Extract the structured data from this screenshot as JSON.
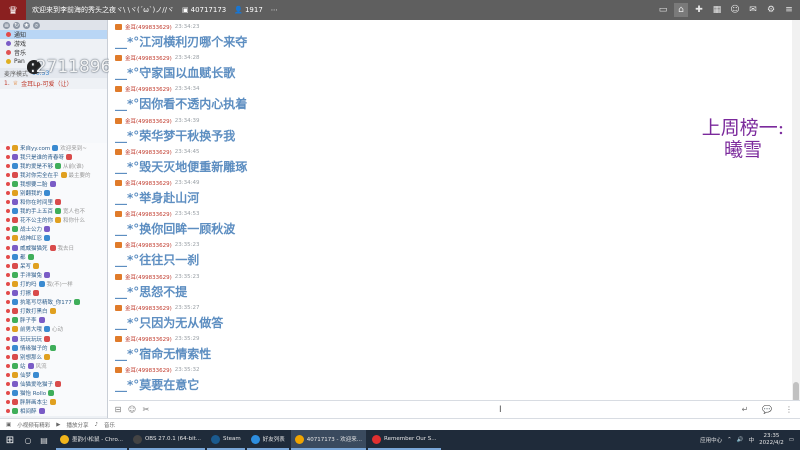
{
  "topbar": {
    "logo": "♛",
    "room_title": "欢迎来到李前海的秀头之夜ヾ\\ \\ヾ(´ω`)ノ//ヾ",
    "room_id": "40717173",
    "viewer_count": "1917",
    "icons": [
      "monitor-icon",
      "home-icon",
      "gamepad-icon",
      "gift-icon",
      "user-icon",
      "mail-icon",
      "settings-icon",
      "menu-icon"
    ]
  },
  "left": {
    "channels": [
      {
        "label": "通知",
        "color": "#e24a4a",
        "selected": true
      },
      {
        "label": "游戏",
        "color": "#7a5cc6",
        "selected": false
      },
      {
        "label": "音乐",
        "color": "#e05353",
        "selected": false
      },
      {
        "label": "Pan",
        "color": "#e0b020",
        "selected": false
      }
    ],
    "mode_label": "麦序模式",
    "mode_time": "00:53",
    "pinned_index": "1.",
    "pinned_text": "金耳Lp-可爱（让）",
    "watermark": ":27118960",
    "users": [
      {
        "name": "来自yy.com",
        "msg": "欢迎来到~"
      },
      {
        "name": "我只是谁的青春呀",
        "msg": ""
      },
      {
        "name": "我的爱是不够",
        "msg": "从前(谁)"
      },
      {
        "name": "我对你完全在乎",
        "msg": "最主要的"
      },
      {
        "name": "我想要二胎",
        "msg": ""
      },
      {
        "name": "别翻我的",
        "msg": ""
      },
      {
        "name": "和你在时间里",
        "msg": ""
      },
      {
        "name": "我的手上五百",
        "msg": "宽人也不"
      },
      {
        "name": "花不公主的你",
        "msg": "和你什么"
      },
      {
        "name": "战士公力",
        "msg": ""
      },
      {
        "name": "战神红忍",
        "msg": ""
      },
      {
        "name": "威威猫猫死",
        "msg": "我去日"
      },
      {
        "name": "都",
        "msg": ""
      },
      {
        "name": "呆写",
        "msg": ""
      },
      {
        "name": "手洋猫兔",
        "msg": ""
      },
      {
        "name": "打的吗",
        "msg": "我(不)一样"
      },
      {
        "name": "打擦",
        "msg": ""
      },
      {
        "name": "执笔写尽精致_你177",
        "msg": ""
      },
      {
        "name": "打数打黑白",
        "msg": ""
      },
      {
        "name": "胖子李",
        "msg": ""
      },
      {
        "name": "前男大哦",
        "msg": "心动"
      },
      {
        "name": "玩玩玩玩",
        "msg": ""
      },
      {
        "name": "情缘猫子的",
        "msg": ""
      },
      {
        "name": "别想那么",
        "msg": ""
      },
      {
        "name": "站",
        "msg": "风流"
      },
      {
        "name": "仙梦",
        "msg": ""
      },
      {
        "name": "仙猫爱吃猫子",
        "msg": ""
      },
      {
        "name": "猫怡 Rollo",
        "msg": ""
      },
      {
        "name": "胖胖画本尘",
        "msg": ""
      },
      {
        "name": "相间醉",
        "msg": ""
      }
    ]
  },
  "chat": {
    "messages": [
      {
        "user": "金耳(499833629)",
        "time": "23:34:23",
        "text": "__*°江河横利刃哪个来夺"
      },
      {
        "user": "金耳(499833629)",
        "time": "23:34:28",
        "text": "__*°守家国以血赋长歌"
      },
      {
        "user": "金耳(499833629)",
        "time": "23:34:34",
        "text": "__*°因你看不透内心执着"
      },
      {
        "user": "金耳(499833629)",
        "time": "23:34:39",
        "text": "__*°荣华梦干秋换予我"
      },
      {
        "user": "金耳(499833629)",
        "time": "23:34:45",
        "text": "__*°毁天灭地便重新雕琢"
      },
      {
        "user": "金耳(499833629)",
        "time": "23:34:49",
        "text": "__*°举身赴山河"
      },
      {
        "user": "金耳(499833629)",
        "time": "23:34:53",
        "text": "__*°换你回眸一顾秋波"
      },
      {
        "user": "金耳(499833629)",
        "time": "23:35:23",
        "text": "__*°往往只一刹"
      },
      {
        "user": "金耳(499833629)",
        "time": "23:35:23",
        "text": "__*°思怨不提"
      },
      {
        "user": "金耳(499833629)",
        "time": "23:35:27",
        "text": "__*°只因为无从做答"
      },
      {
        "user": "金耳(499833629)",
        "time": "23:35:29",
        "text": "__*°宿命无情索性"
      },
      {
        "user": "金耳(499833629)",
        "time": "23:35:32",
        "text": "__*°莫要在意它"
      }
    ],
    "side_line1": "上周榜一:",
    "side_line2": "曦雪"
  },
  "input": {
    "cursor_glyph": "I"
  },
  "status": {
    "items": [
      "小视频有精彩",
      "播放分享",
      "音乐"
    ]
  },
  "taskbar": {
    "tasks": [
      {
        "label": "墨韵小松鼠 - Chro...",
        "color": "#f2b51b",
        "active": false
      },
      {
        "label": "OBS 27.0.1 (64-bit...",
        "color": "#444",
        "active": false
      },
      {
        "label": "Steam",
        "color": "#1b5a8e",
        "active": false
      },
      {
        "label": "好友列表",
        "color": "#2d8ee0",
        "active": false
      },
      {
        "label": "40717173 - 欢迎来...",
        "color": "#f0a400",
        "active": true
      },
      {
        "label": "Remember Our S...",
        "color": "#e03030",
        "active": false
      }
    ],
    "tray_label": "应用中心",
    "time": "23:35",
    "date": "2022/4/2"
  }
}
